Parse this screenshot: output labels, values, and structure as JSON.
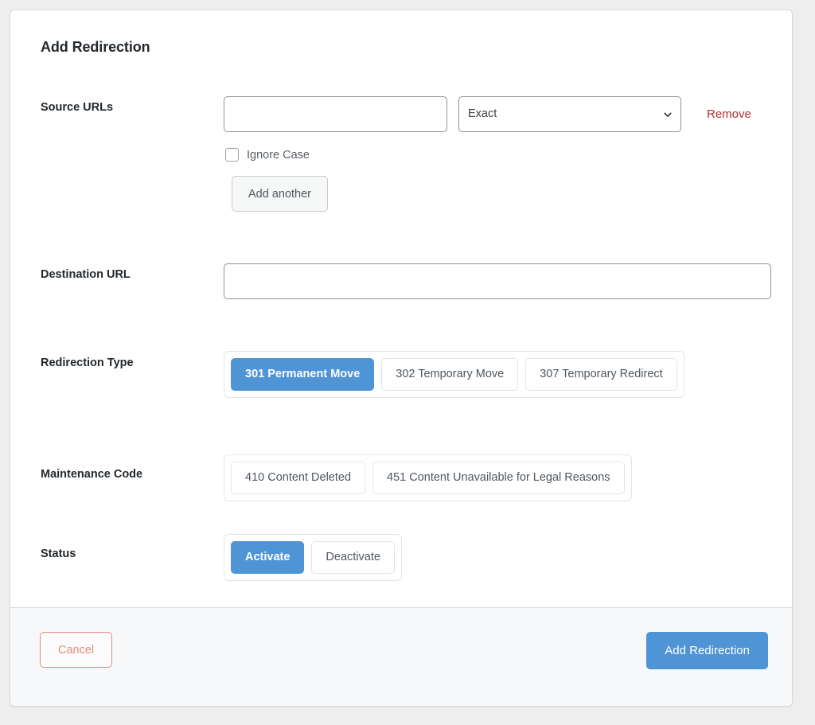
{
  "card": {
    "title": "Add Redirection"
  },
  "source_urls": {
    "label": "Source URLs",
    "url_input_value": "",
    "url_input_placeholder": "",
    "match_select_value": "Exact",
    "match_select_icon": "chevron-down-icon",
    "remove_label": "Remove",
    "ignore_case_label": "Ignore Case",
    "ignore_case_checked": false,
    "add_another_label": "Add another"
  },
  "destination_url": {
    "label": "Destination URL",
    "input_value": "",
    "input_placeholder": ""
  },
  "redirection_type": {
    "label": "Redirection Type",
    "options": [
      {
        "label": "301 Permanent Move",
        "selected": true
      },
      {
        "label": "302 Temporary Move",
        "selected": false
      },
      {
        "label": "307 Temporary Redirect",
        "selected": false
      }
    ]
  },
  "maintenance_code": {
    "label": "Maintenance Code",
    "options": [
      {
        "label": "410 Content Deleted",
        "selected": false
      },
      {
        "label": "451 Content Unavailable for Legal Reasons",
        "selected": false
      }
    ]
  },
  "status": {
    "label": "Status",
    "options": [
      {
        "label": "Activate",
        "selected": true
      },
      {
        "label": "Deactivate",
        "selected": false
      }
    ]
  },
  "footer": {
    "cancel_label": "Cancel",
    "submit_label": "Add Redirection"
  },
  "colors": {
    "accent_blue": "#4f94d4",
    "cancel_coral": "#e8897d",
    "remove_red": "#b32d2e",
    "page_bg": "#eeeeee",
    "footer_bg": "#f7f8f9",
    "card_border": "#d7dade"
  }
}
